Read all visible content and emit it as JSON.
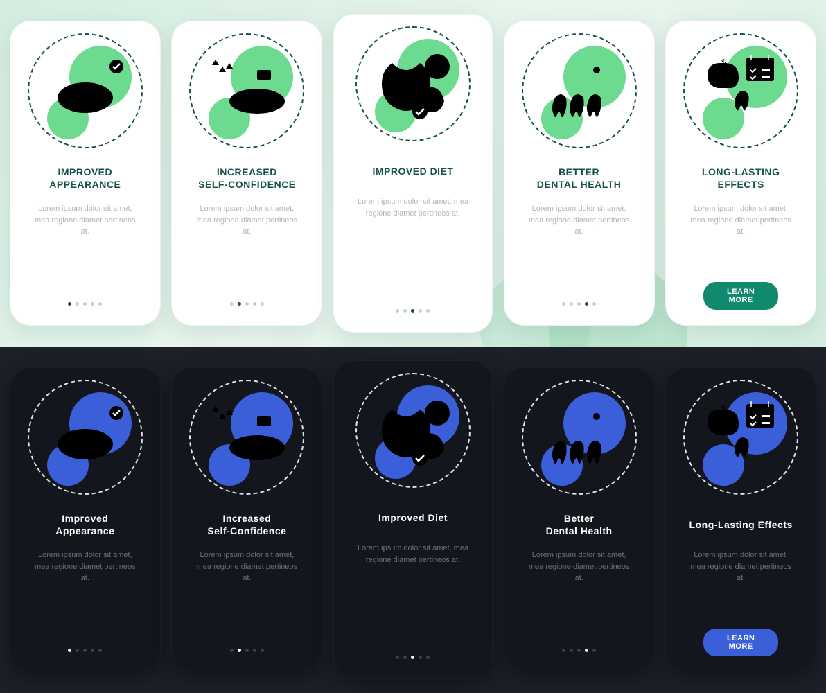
{
  "lorem": "Lorem ipsum dolor sit amet, mea regione diamet pertineos at.",
  "cta_label": "LEARN MORE",
  "light": {
    "screens": [
      {
        "title": "IMPROVED\nAPPEARANCE",
        "icon": "appearance"
      },
      {
        "title": "INCREASED\nSELF-CONFIDENCE",
        "icon": "confidence"
      },
      {
        "title": "IMPROVED DIET",
        "icon": "diet",
        "featured": true
      },
      {
        "title": "BETTER\nDENTAL HEALTH",
        "icon": "dental"
      },
      {
        "title": "LONG-LASTING EFFECTS",
        "icon": "lasting",
        "cta": true
      }
    ]
  },
  "dark": {
    "screens": [
      {
        "title": "Improved\nAppearance",
        "icon": "appearance"
      },
      {
        "title": "Increased\nSelf-Confidence",
        "icon": "confidence"
      },
      {
        "title": "Improved Diet",
        "icon": "diet",
        "featured": true
      },
      {
        "title": "Better\nDental Health",
        "icon": "dental"
      },
      {
        "title": "Long-Lasting Effects",
        "icon": "lasting",
        "cta": true
      }
    ]
  }
}
